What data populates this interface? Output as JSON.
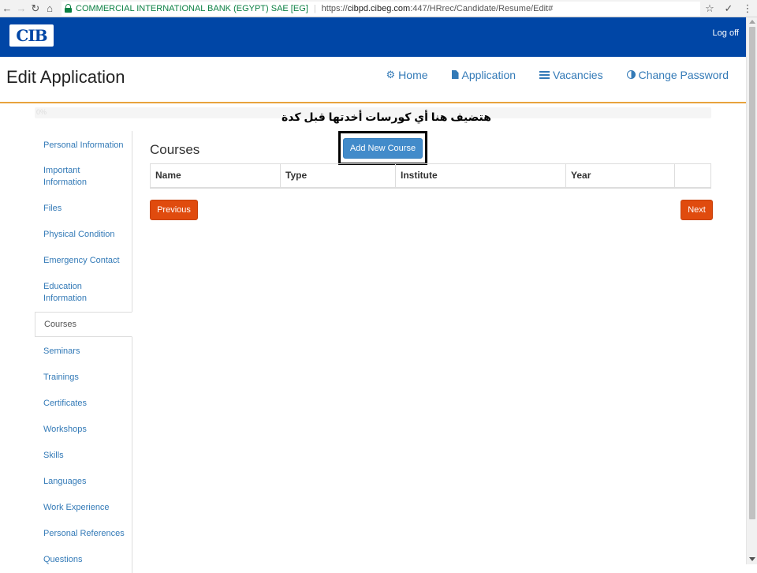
{
  "browser": {
    "back": "←",
    "forward": "→",
    "reload": "↻",
    "home": "⌂",
    "cert_name": "COMMERCIAL INTERNATIONAL BANK (EGYPT) SAE [EG]",
    "url_scheme": "https://",
    "url_host": "cibpd.cibeg.com",
    "url_path": ":447/HRrec/Candidate/Resume/Edit#",
    "star": "☆",
    "ext": "✓",
    "menu": "⋮"
  },
  "header": {
    "logo_text": "CIB",
    "logoff": "Log off",
    "brand_color": "#0046a6"
  },
  "page": {
    "title": "Edit Application",
    "nav": {
      "home": "Home",
      "application": "Application",
      "vacancies": "Vacancies",
      "change_password": "Change Password"
    },
    "progress_label": "0%",
    "annotation": "هتضيف هنا أي كورسات أخدتها قبل كدة"
  },
  "sidebar": {
    "items": [
      "Personal Information",
      "Important Information",
      "Files",
      "Physical Condition",
      "Emergency Contact",
      "Education Information",
      "Courses",
      "Seminars",
      "Trainings",
      "Certificates",
      "Workshops",
      "Skills",
      "Languages",
      "Work Experience",
      "Personal References",
      "Questions"
    ],
    "active": "Courses"
  },
  "main": {
    "section_title": "Courses",
    "add_button": "Add New Course",
    "table_headers": [
      "Name",
      "Type",
      "Institute",
      "Year",
      ""
    ],
    "previous": "Previous",
    "next": "Next"
  }
}
